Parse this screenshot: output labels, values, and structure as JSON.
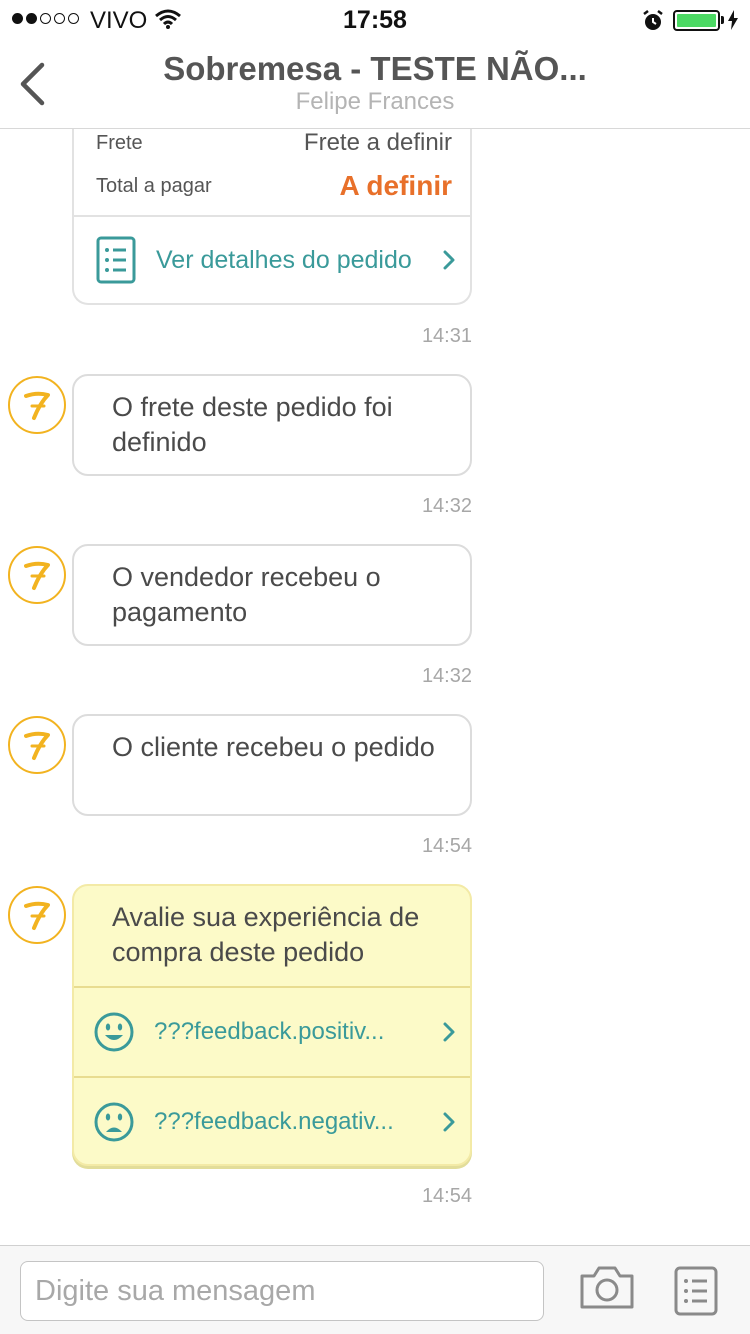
{
  "status_bar": {
    "carrier": "VIVO",
    "time": "17:58",
    "signal_bars_filled": 2,
    "signal_bars_total": 5,
    "battery_level": 1.0
  },
  "nav": {
    "title": "Sobremesa - TESTE NÃO...",
    "subtitle": "Felipe Frances"
  },
  "order_card": {
    "shipping_label": "Frete",
    "shipping_value": "Frete a definir",
    "total_label": "Total a pagar",
    "total_value": "A definir",
    "details_link": "Ver detalhes do pedido",
    "time": "14:31"
  },
  "messages": [
    {
      "text": "O frete deste pedido foi definido",
      "time": "14:32"
    },
    {
      "text": "O vendedor recebeu o pagamento",
      "time": "14:32"
    },
    {
      "text": "O cliente recebeu o pedido",
      "time": "14:54"
    }
  ],
  "rating": {
    "prompt": "Avalie sua experiência de compra deste pedido",
    "positive_label": "???feedback.positiv...",
    "negative_label": "???feedback.negativ...",
    "time": "14:54"
  },
  "composer": {
    "placeholder": "Digite sua mensagem"
  },
  "colors": {
    "accent_teal": "#3a9a9a",
    "accent_orange": "#e8702a",
    "avatar_ring": "#f2b320",
    "rating_bg": "#fcfac8",
    "battery_green": "#4cd964"
  },
  "icons": {
    "back": "chevron-left-icon",
    "details": "list-document-icon",
    "avatar": "seven-logo-icon",
    "positive": "smile-face-icon",
    "negative": "sad-face-icon",
    "camera": "camera-icon",
    "order_list": "list-document-icon"
  }
}
